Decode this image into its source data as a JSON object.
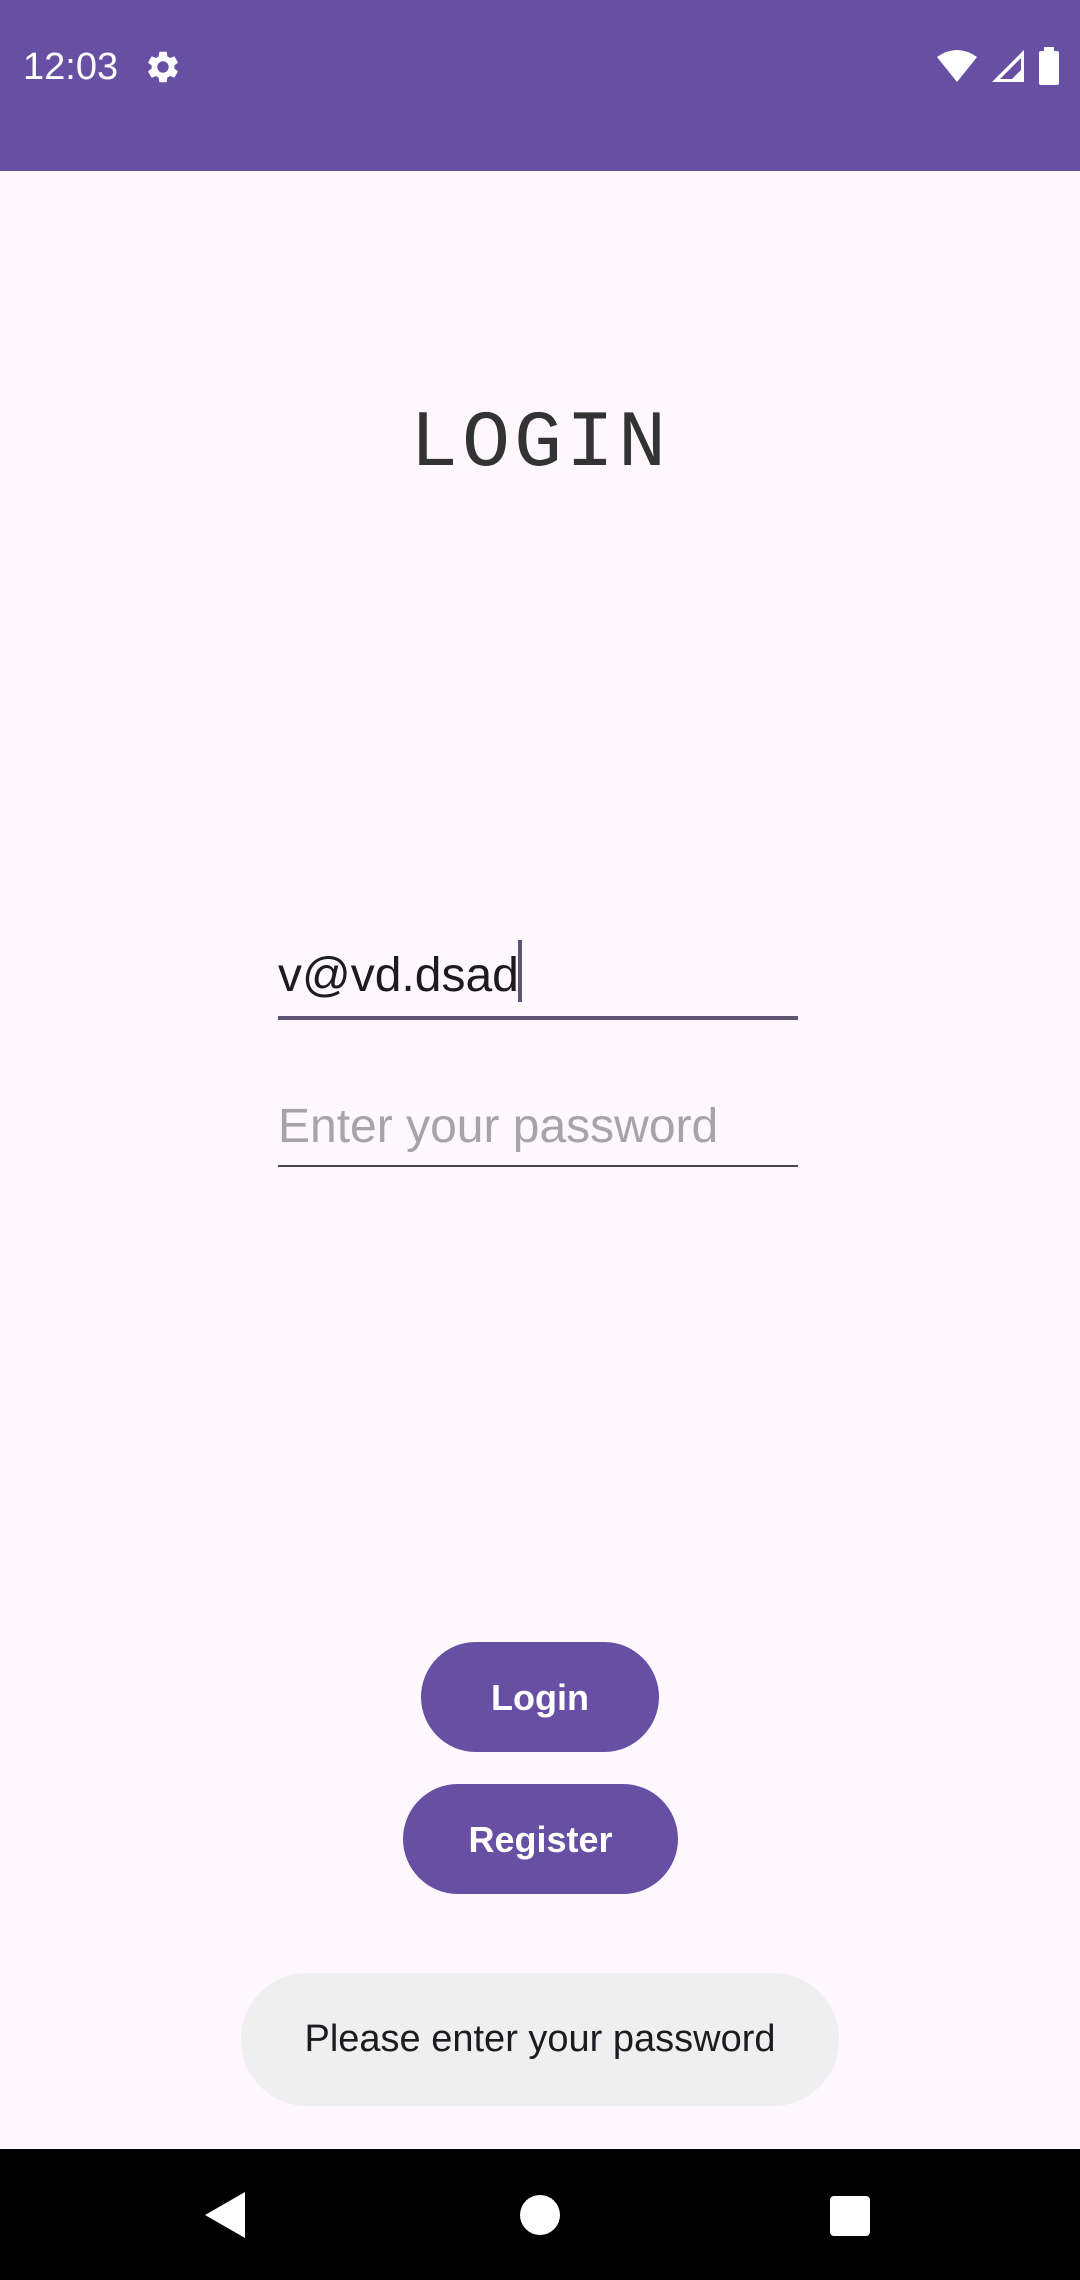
{
  "status_bar": {
    "time": "12:03",
    "icons": [
      "settings-gear-icon",
      "wifi-icon",
      "cellular-signal-icon",
      "battery-icon"
    ],
    "background_color": "#6750A4"
  },
  "screen": {
    "title": "LOGIN"
  },
  "form": {
    "email_value": "v@vd.dsad",
    "password_placeholder": "Enter your password"
  },
  "buttons": {
    "login_label": "Login",
    "register_label": "Register",
    "color": "#6750A4"
  },
  "toast": {
    "message": "Please enter your password"
  },
  "nav_bar": {
    "icons": [
      "back-icon",
      "home-icon",
      "recents-icon"
    ]
  }
}
